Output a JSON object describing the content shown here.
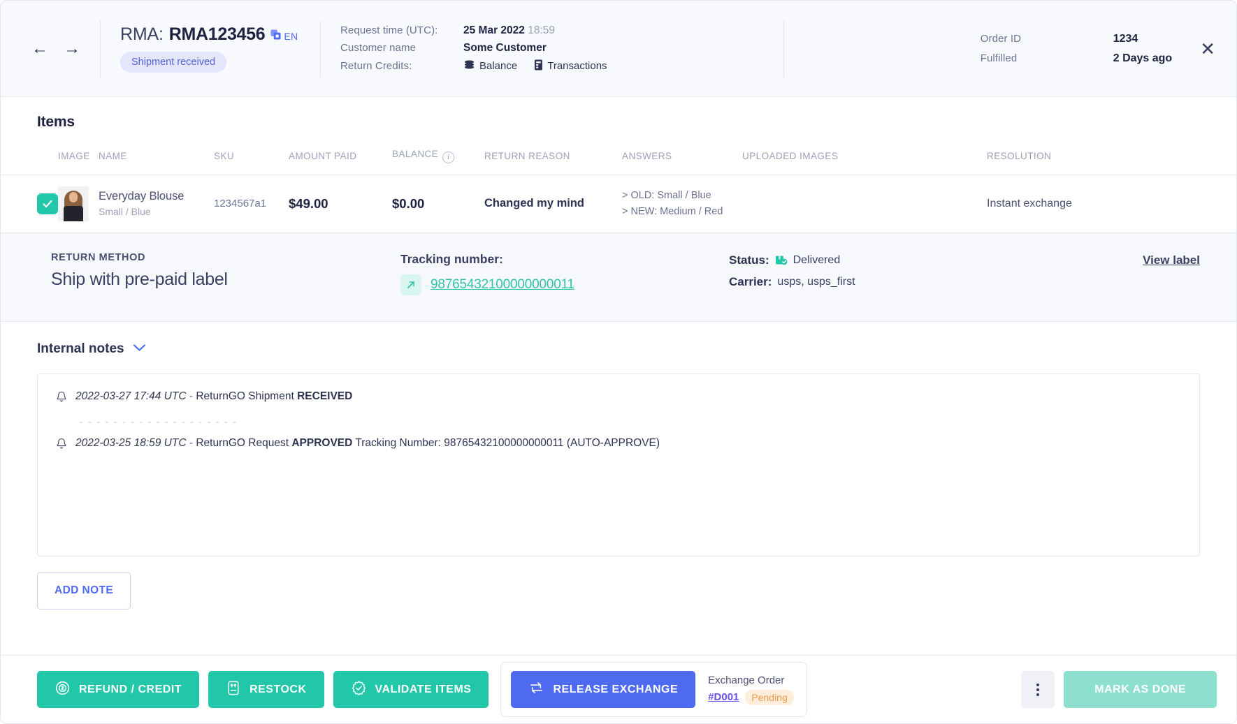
{
  "header": {
    "back_arrow": "←",
    "forward_arrow": "→",
    "rma_label": "RMA:",
    "rma_value": "RMA123456",
    "lang": "EN",
    "status_pill": "Shipment received",
    "request_time_label": "Request time (UTC):",
    "request_time_date": "25 Mar 2022",
    "request_time_clock": "18:59",
    "customer_name_label": "Customer name",
    "customer_name_value": "Some Customer",
    "return_credits_label": "Return Credits:",
    "balance_link": "Balance",
    "transactions_link": "Transactions",
    "order_id_label": "Order ID",
    "order_id_value": "1234",
    "fulfilled_label": "Fulfilled",
    "fulfilled_value": "2 Days ago",
    "close": "✕"
  },
  "items": {
    "title": "Items",
    "columns": [
      "IMAGE",
      "NAME",
      "SKU",
      "AMOUNT PAID",
      "BALANCE",
      "RETURN REASON",
      "ANSWERS",
      "UPLOADED IMAGES",
      "RESOLUTION"
    ],
    "rows": [
      {
        "checked": true,
        "name": "Everyday Blouse",
        "variant": "Small / Blue",
        "sku": "1234567a1",
        "amount_paid": "$49.00",
        "balance": "$0.00",
        "return_reason": "Changed my mind",
        "answer_old": "> OLD: Small / Blue",
        "answer_new": "> NEW: Medium / Red",
        "uploaded_images": "",
        "resolution": "Instant exchange"
      }
    ]
  },
  "return_method": {
    "label": "RETURN METHOD",
    "value": "Ship with pre-paid label",
    "tracking_label": "Tracking number:",
    "tracking_number": "98765432100000000011",
    "status_label": "Status:",
    "status_value": "Delivered",
    "carrier_label": "Carrier:",
    "carrier_value": "usps, usps_first",
    "view_label": "View label"
  },
  "notes": {
    "title": "Internal notes",
    "entries": [
      {
        "timestamp": "2022-03-27 17:44 UTC",
        "dash": "-",
        "prefix": "ReturnGO Shipment",
        "bold": "RECEIVED",
        "suffix": ""
      },
      {
        "timestamp": "2022-03-25 18:59 UTC",
        "dash": "-",
        "prefix": "ReturnGO Request",
        "bold": "APPROVED",
        "suffix": "Tracking Number: 98765432100000000011 (AUTO-APPROVE)"
      }
    ],
    "separator": "- - - - - - - - - - - - - - - - - - -",
    "add_note_label": "ADD NOTE"
  },
  "footer": {
    "refund_label": "REFUND / CREDIT",
    "restock_label": "RESTOCK",
    "validate_label": "VALIDATE ITEMS",
    "release_exchange_label": "RELEASE EXCHANGE",
    "exchange_order_title": "Exchange Order",
    "exchange_order_id": "#D001",
    "exchange_order_status": "Pending",
    "mark_as_done_label": "MARK AS DONE"
  },
  "colors": {
    "teal": "#22c7a9",
    "teal_light": "#8ddfd0",
    "blue": "#4e6af0",
    "purple_link": "#6d4ef0",
    "orange_badge": "#f2994a",
    "pill_bg": "#e4e6fb",
    "pill_text": "#5560d8"
  }
}
